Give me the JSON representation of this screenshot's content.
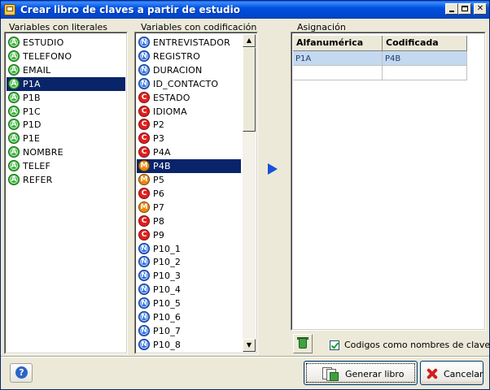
{
  "window": {
    "title": "Crear libro de claves a partir de estudio"
  },
  "literals": {
    "label": "Variables con literales",
    "items": [
      {
        "badge": "A",
        "label": "ESTUDIO",
        "selected": false
      },
      {
        "badge": "A",
        "label": "TELEFONO",
        "selected": false
      },
      {
        "badge": "A",
        "label": "EMAIL",
        "selected": false
      },
      {
        "badge": "A",
        "label": "P1A",
        "selected": true
      },
      {
        "badge": "A",
        "label": "P1B",
        "selected": false
      },
      {
        "badge": "A",
        "label": "P1C",
        "selected": false
      },
      {
        "badge": "A",
        "label": "P1D",
        "selected": false
      },
      {
        "badge": "A",
        "label": "P1E",
        "selected": false
      },
      {
        "badge": "A",
        "label": "NOMBRE",
        "selected": false
      },
      {
        "badge": "A",
        "label": "TELEF",
        "selected": false
      },
      {
        "badge": "A",
        "label": "REFER",
        "selected": false
      }
    ]
  },
  "coded": {
    "label": "Variables con codificación",
    "items": [
      {
        "badge": "N",
        "label": "ENTREVISTADOR",
        "selected": false
      },
      {
        "badge": "N",
        "label": "REGISTRO",
        "selected": false
      },
      {
        "badge": "N",
        "label": "DURACION",
        "selected": false
      },
      {
        "badge": "N",
        "label": "ID_CONTACTO",
        "selected": false
      },
      {
        "badge": "C",
        "label": "ESTADO",
        "selected": false
      },
      {
        "badge": "C",
        "label": "IDIOMA",
        "selected": false
      },
      {
        "badge": "C",
        "label": "P2",
        "selected": false
      },
      {
        "badge": "C",
        "label": "P3",
        "selected": false
      },
      {
        "badge": "C",
        "label": "P4A",
        "selected": false
      },
      {
        "badge": "M",
        "label": "P4B",
        "selected": true
      },
      {
        "badge": "M",
        "label": "P5",
        "selected": false
      },
      {
        "badge": "C",
        "label": "P6",
        "selected": false
      },
      {
        "badge": "M",
        "label": "P7",
        "selected": false
      },
      {
        "badge": "C",
        "label": "P8",
        "selected": false
      },
      {
        "badge": "C",
        "label": "P9",
        "selected": false
      },
      {
        "badge": "N",
        "label": "P10_1",
        "selected": false
      },
      {
        "badge": "N",
        "label": "P10_2",
        "selected": false
      },
      {
        "badge": "N",
        "label": "P10_3",
        "selected": false
      },
      {
        "badge": "N",
        "label": "P10_4",
        "selected": false
      },
      {
        "badge": "N",
        "label": "P10_5",
        "selected": false
      },
      {
        "badge": "N",
        "label": "P10_6",
        "selected": false
      },
      {
        "badge": "N",
        "label": "P10_7",
        "selected": false
      },
      {
        "badge": "N",
        "label": "P10_8",
        "selected": false
      }
    ]
  },
  "assignment": {
    "label": "Asignación",
    "columns": [
      "Alfanumérica",
      "Codificada"
    ],
    "rows": [
      {
        "alfa": "P1A",
        "cod": "P4B",
        "selected": true
      },
      {
        "alfa": "",
        "cod": "",
        "selected": false
      }
    ]
  },
  "options": {
    "codes_as_keys_label": "Codigos como nombres de clave",
    "codes_as_keys_checked": true
  },
  "buttons": {
    "generate": "Generar libro",
    "cancel": "Cancelar"
  },
  "icons": {
    "add": "right-arrow-icon",
    "recycle": "recycle-bin-icon",
    "help": "help-icon",
    "generate": "book-icon",
    "cancel": "red-x-icon"
  },
  "colors": {
    "selection": "#0a246a",
    "grid_selection": "#c4d8f0",
    "titlebar": "#0050e0"
  }
}
